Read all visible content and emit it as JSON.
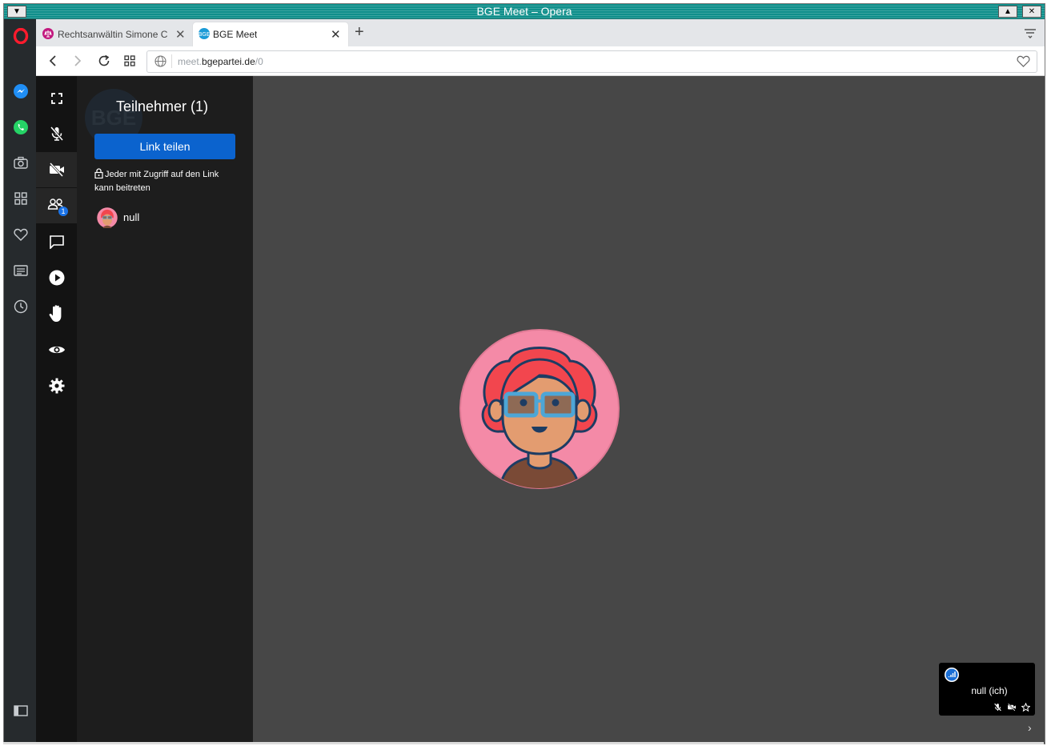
{
  "window": {
    "title": "BGE Meet – Opera",
    "min_glyph": "▲",
    "close_glyph": "✕",
    "menu_glyph": "▼"
  },
  "tabs": [
    {
      "label": "Rechtsanwältin Simone C",
      "active": false,
      "icon": "law-scales-icon",
      "icon_color": "#c2187e"
    },
    {
      "label": "BGE Meet",
      "active": true,
      "icon": "bge-logo-icon",
      "icon_color": "#1a9bd7"
    }
  ],
  "new_tab_glyph": "+",
  "address": {
    "url_prefix": "meet.",
    "url_domain": "bgepartei.de",
    "url_path": "/0"
  },
  "participants_panel": {
    "bg_mark": "BGE",
    "title": "Teilnehmer (1)",
    "share_button": "Link teilen",
    "access_note": "Jeder mit Zugriff auf den Link kann beitreten",
    "participants": [
      {
        "name": "null"
      }
    ],
    "badge_count": "1"
  },
  "self_tile": {
    "name": "null (ich)"
  },
  "colors": {
    "accent_blue": "#0b63ce",
    "stage_bg": "#474747",
    "titlebar": "#0f8f8b",
    "avatar_pink": "#f48aa7"
  }
}
